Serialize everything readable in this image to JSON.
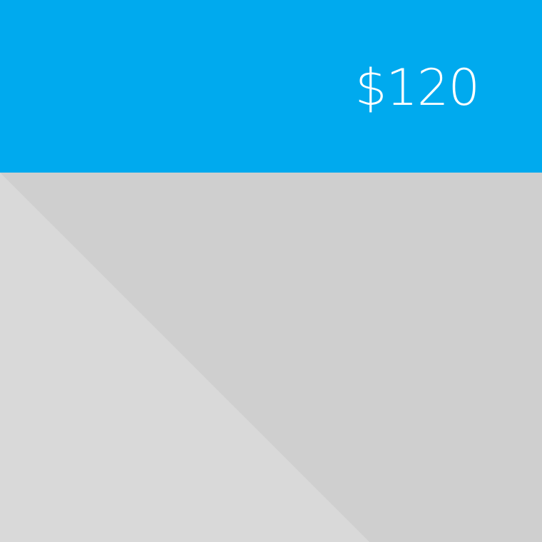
{
  "product": {
    "price": "$120"
  },
  "colors": {
    "header_background": "#00aaee",
    "price_text": "#ffffff",
    "placeholder_light": "#d9d9d9",
    "placeholder_dark": "#cfcfcf"
  }
}
